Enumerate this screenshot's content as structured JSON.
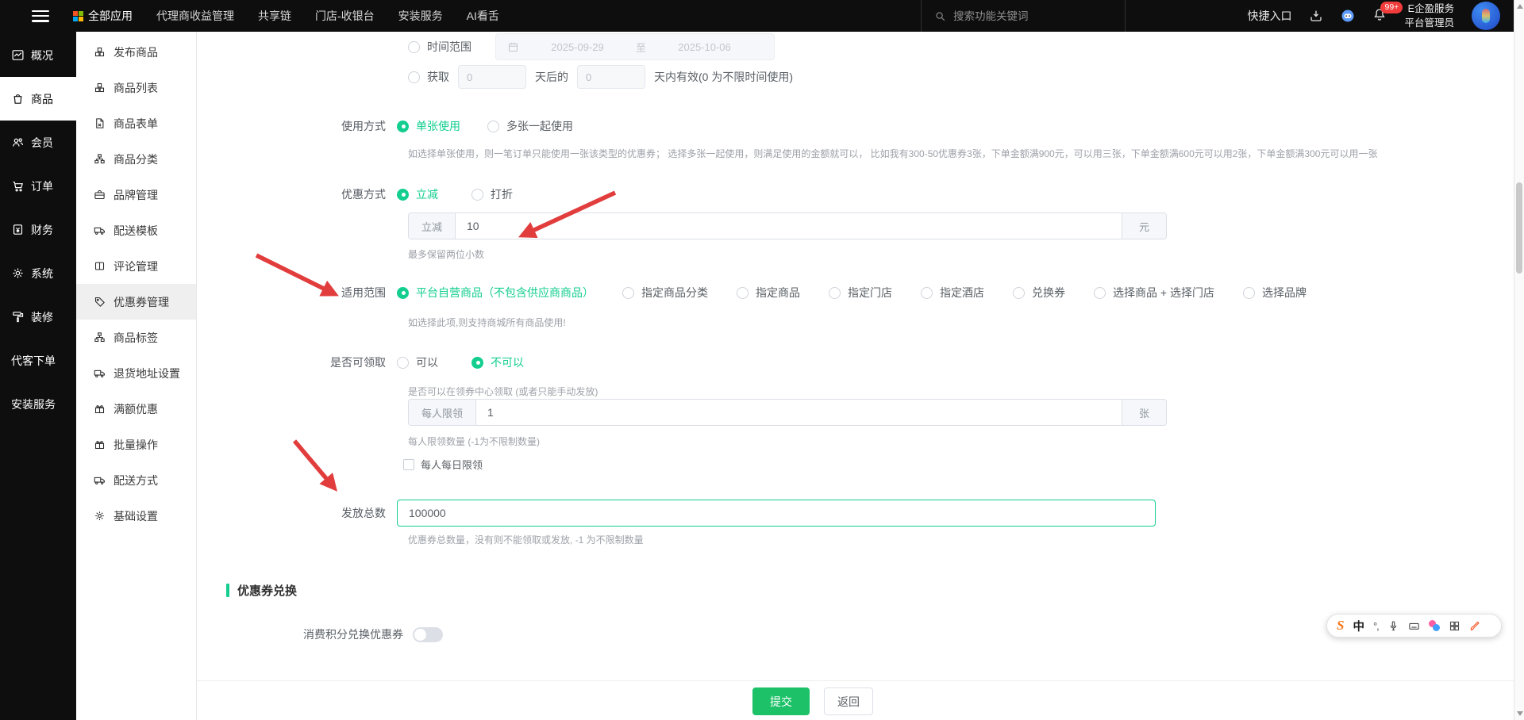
{
  "colors": {
    "accent": "#13ce8f",
    "submit_button": "#1dc268",
    "arrow_red": "#e23d3d",
    "navbar_bg": "#0e0e0e",
    "badge_red": "#f23c3c"
  },
  "navbar": {
    "menu": [
      {
        "label": "全部应用"
      },
      {
        "label": "代理商收益管理"
      },
      {
        "label": "共享链"
      },
      {
        "label": "门店-收银台"
      },
      {
        "label": "安装服务"
      },
      {
        "label": "AI看舌"
      }
    ],
    "search_placeholder": "搜索功能关键词",
    "quick_entry": "快捷入口",
    "notification_badge": "99+",
    "account": {
      "line1": "E企盈服务",
      "line2": "平台管理员"
    }
  },
  "primary_sidebar": {
    "items": [
      {
        "label": "概况",
        "icon": "chart-icon",
        "active": false
      },
      {
        "label": "商品",
        "icon": "goods-bag-icon",
        "active": true
      },
      {
        "label": "会员",
        "icon": "members-icon",
        "active": false
      },
      {
        "label": "订单",
        "icon": "cart-icon",
        "active": false
      },
      {
        "label": "财务",
        "icon": "finance-icon",
        "active": false
      },
      {
        "label": "系统",
        "icon": "gear-icon",
        "active": false
      },
      {
        "label": "装修",
        "icon": "paint-roller-icon",
        "active": false
      },
      {
        "label": "代客下单",
        "icon": "",
        "active": false
      },
      {
        "label": "安装服务",
        "icon": "",
        "active": false
      }
    ]
  },
  "secondary_sidebar": {
    "items": [
      {
        "label": "发布商品",
        "icon": "cubes-icon",
        "active": false
      },
      {
        "label": "商品列表",
        "icon": "cubes-icon",
        "active": false
      },
      {
        "label": "商品表单",
        "icon": "file-icon",
        "active": false
      },
      {
        "label": "商品分类",
        "icon": "tree-icon",
        "active": false
      },
      {
        "label": "品牌管理",
        "icon": "briefcase-icon",
        "active": false
      },
      {
        "label": "配送模板",
        "icon": "truck-icon",
        "active": false
      },
      {
        "label": "评论管理",
        "icon": "columns-icon",
        "active": false
      },
      {
        "label": "优惠券管理",
        "icon": "tag-icon",
        "active": true
      },
      {
        "label": "商品标签",
        "icon": "tree-icon",
        "active": false
      },
      {
        "label": "退货地址设置",
        "icon": "truck-icon",
        "active": false
      },
      {
        "label": "满额优惠",
        "icon": "gift-icon",
        "active": false
      },
      {
        "label": "批量操作",
        "icon": "gift-icon",
        "active": false
      },
      {
        "label": "配送方式",
        "icon": "truck-icon",
        "active": false
      },
      {
        "label": "基础设置",
        "icon": "gear-icon",
        "active": false
      }
    ]
  },
  "form": {
    "time_range": {
      "label": "时间范围",
      "start_date": "2025-09-29",
      "separator": "至",
      "end_date": "2025-10-06"
    },
    "acquire": {
      "label": "获取",
      "days_value": "0",
      "middle_label": "天后的",
      "valid_value": "0",
      "suffix_label": "天内有效(0 为不限时间使用)"
    },
    "usage": {
      "label": "使用方式",
      "option1": "单张使用",
      "option2": "多张一起使用",
      "help": "如选择单张使用，则一笔订单只能使用一张该类型的优惠券； 选择多张一起使用，则满足使用的金额就可以， 比如我有300-50优惠券3张，下单金额满900元，可以用三张，下单金额满600元可以用2张，下单金额满300元可以用一张"
    },
    "discount": {
      "label": "优惠方式",
      "option1": "立减",
      "option2": "打折",
      "input_prefix": "立减",
      "input_value": "10",
      "input_suffix": "元",
      "help": "最多保留两位小数"
    },
    "scope": {
      "label": "适用范围",
      "options": [
        "平台自营商品（不包含供应商商品）",
        "指定商品分类",
        "指定商品",
        "指定门店",
        "指定酒店",
        "兑换券",
        "选择商品 + 选择门店",
        "选择品牌"
      ],
      "help": "如选择此项,则支持商城所有商品使用!"
    },
    "claim": {
      "label": "是否可领取",
      "option1": "可以",
      "option2": "不可以",
      "help": "是否可以在领券中心领取 (或者只能手动发放)",
      "limit_prefix": "每人限领",
      "limit_value": "1",
      "limit_suffix": "张",
      "limit_help": "每人限领数量 (-1为不限制数量)",
      "daily_limit_label": "每人每日限领"
    },
    "total": {
      "label": "发放总数",
      "value": "100000",
      "help": "优惠券总数量，没有则不能领取或发放, -1 为不限制数量"
    },
    "exchange": {
      "section_title": "优惠券兑换",
      "toggle_label": "消费积分兑换优惠券",
      "toggle_on": false
    },
    "footer": {
      "submit": "提交",
      "back": "返回"
    }
  },
  "ime": {
    "logo": "S",
    "mode": "中",
    "punct": "°,"
  }
}
